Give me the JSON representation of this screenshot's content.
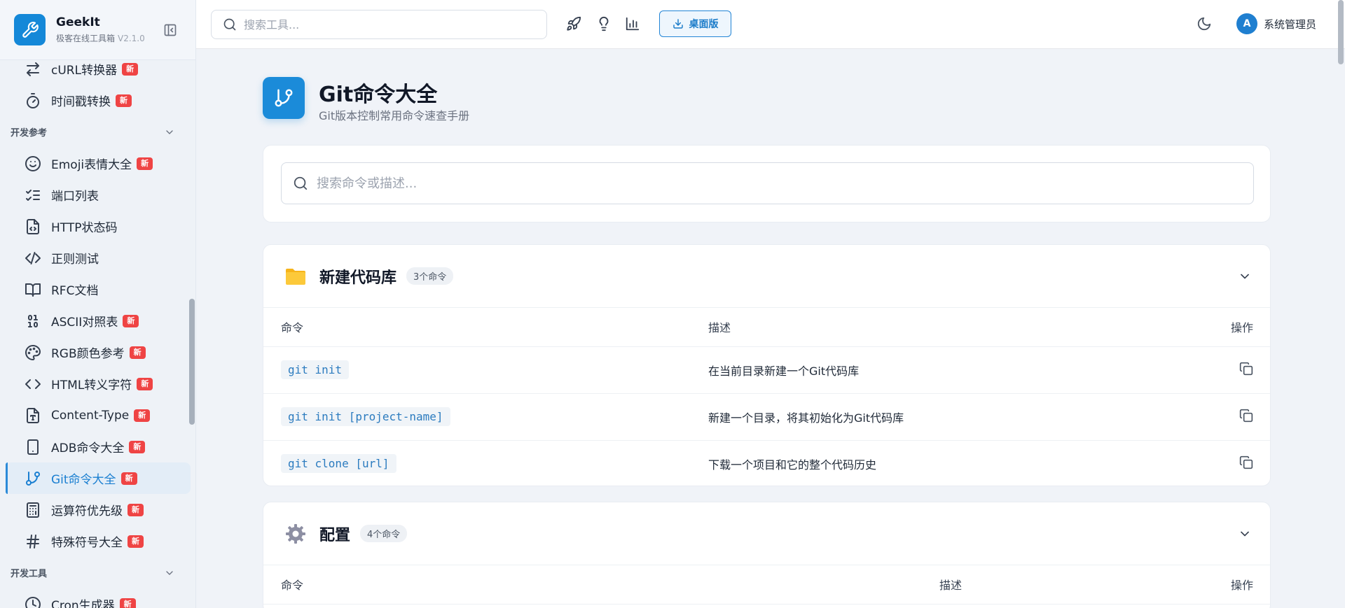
{
  "brand": {
    "name": "GeekIt",
    "subtitle": "极客在线工具箱",
    "version": "V2.1.0"
  },
  "sidebar": {
    "items_top": [
      {
        "label": "cURL转换器",
        "badge": "新",
        "icon": "arrows-swap-icon"
      },
      {
        "label": "时间戳转换",
        "badge": "新",
        "icon": "stopwatch-icon"
      }
    ],
    "section_dev_ref": "开发参考",
    "items_ref": [
      {
        "label": "Emoji表情大全",
        "badge": "新",
        "icon": "smile-icon"
      },
      {
        "label": "端口列表",
        "badge": "",
        "icon": "list-checks-icon"
      },
      {
        "label": "HTTP状态码",
        "badge": "",
        "icon": "file-code-icon"
      },
      {
        "label": "正则测试",
        "badge": "",
        "icon": "code-slash-icon"
      },
      {
        "label": "RFC文档",
        "badge": "",
        "icon": "book-icon"
      },
      {
        "label": "ASCII对照表",
        "badge": "新",
        "icon": "binary-icon"
      },
      {
        "label": "RGB颜色参考",
        "badge": "新",
        "icon": "palette-icon"
      },
      {
        "label": "HTML转义字符",
        "badge": "新",
        "icon": "code-brackets-icon"
      },
      {
        "label": "Content-Type",
        "badge": "新",
        "icon": "file-type-icon"
      },
      {
        "label": "ADB命令大全",
        "badge": "新",
        "icon": "smartphone-icon"
      },
      {
        "label": "Git命令大全",
        "badge": "新",
        "icon": "git-branch-icon"
      },
      {
        "label": "运算符优先级",
        "badge": "新",
        "icon": "calculator-icon"
      },
      {
        "label": "特殊符号大全",
        "badge": "新",
        "icon": "hash-icon"
      }
    ],
    "section_dev_tools": "开发工具",
    "item_partial": {
      "label": "Cron生成器",
      "badge": "新"
    }
  },
  "header": {
    "search_placeholder": "搜索工具...",
    "desktop_label": "桌面版",
    "user_initial": "A",
    "user_name": "系统管理员"
  },
  "page": {
    "title": "Git命令大全",
    "subtitle": "Git版本控制常用命令速查手册",
    "search_placeholder": "搜索命令或描述..."
  },
  "columns": {
    "command": "命令",
    "description": "描述",
    "action": "操作"
  },
  "sections": [
    {
      "emoji": "folder",
      "title": "新建代码库",
      "count": "3个命令",
      "rows": [
        {
          "cmd": "git init",
          "desc": "在当前目录新建一个Git代码库"
        },
        {
          "cmd": "git init [project-name]",
          "desc": "新建一个目录，将其初始化为Git代码库"
        },
        {
          "cmd": "git clone [url]",
          "desc": "下载一个项目和它的整个代码历史"
        }
      ]
    },
    {
      "emoji": "gear",
      "title": "配置",
      "count": "4个命令",
      "rows": []
    }
  ],
  "colors": {
    "accent": "#1b8bd9",
    "badge": "#ef4444",
    "code": "#2b7bbf"
  }
}
